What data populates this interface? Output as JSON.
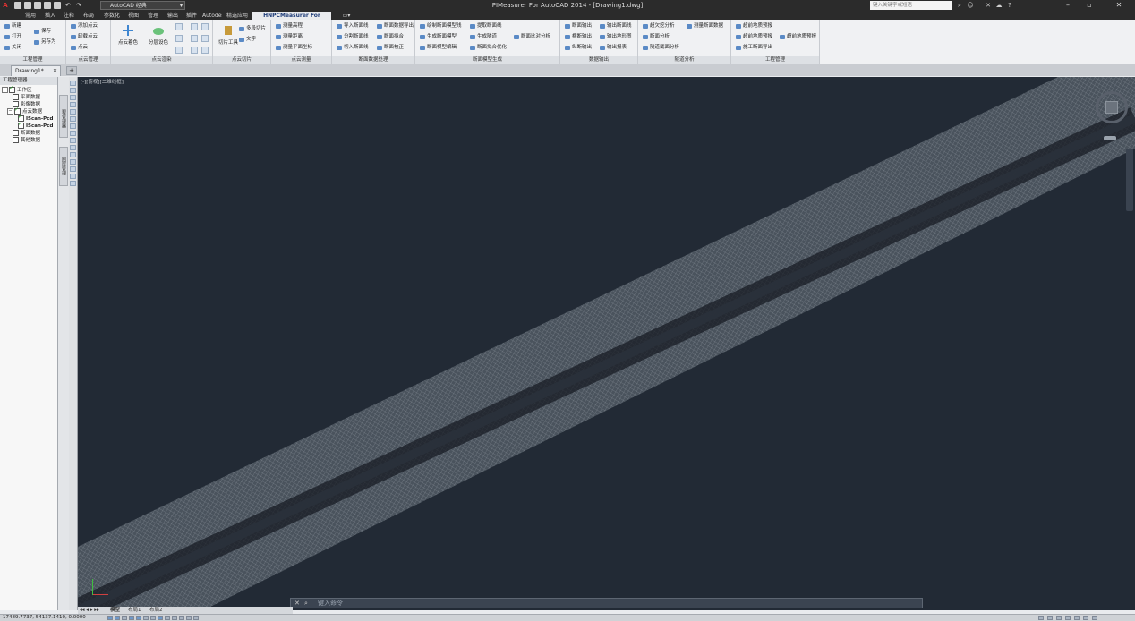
{
  "titlebar": {
    "workspace": "AutoCAD 经典",
    "title": "PIMeasurer For AutoCAD 2014 - [Drawing1.dwg]",
    "search_placeholder": "键入关键字或短语"
  },
  "ribbon_tabs": [
    "常用",
    "插入",
    "注释",
    "布局",
    "参数化",
    "视图",
    "管理",
    "输出",
    "插件",
    "Autodesk 360",
    "精选应用",
    "HNPCMeasurer For AutoCAD"
  ],
  "active_tab": "HNPCMeasurer For AutoCAD",
  "panels": {
    "p1": {
      "title": "工程管理",
      "items": [
        "新建",
        "打开",
        "关闭",
        "保存",
        "另存为"
      ]
    },
    "p2": {
      "title": "点云管理",
      "items": [
        "添加点云",
        "卸载点云",
        "点云"
      ]
    },
    "p3": {
      "title": "点云渲染",
      "big1": "点云着色",
      "big2": "分层设色"
    },
    "p4": {
      "title": "点云切片",
      "big": "切片工具",
      "items": [
        "多段切片",
        "文字"
      ]
    },
    "p5": {
      "title": "点云测量",
      "items": [
        "测量高程",
        "测量距离",
        "测量平面坐标"
      ]
    },
    "p6": {
      "title": "断面数据处理",
      "items": [
        "导入断面线",
        "分割断面线",
        "切入断面线",
        "断面数据导出",
        "断面拟合",
        "断面校正"
      ]
    },
    "p7": {
      "title": "断面模型生成",
      "items": [
        "绘制断面模型线",
        "生成断面模型",
        "断面模型编辑",
        "提取断面线",
        "生成隧道",
        "断面拟合优化",
        "断面比对分析"
      ]
    },
    "p8": {
      "title": "数据输出",
      "items": [
        "断面输出",
        "横断输出",
        "纵断输出",
        "输出断面线",
        "输出地形图",
        "输出报表"
      ]
    },
    "p9": {
      "title": "隧道分析",
      "items": [
        "超欠挖分析",
        "断面分析",
        "隧道截面分析",
        "测量断面数据"
      ]
    },
    "p10": {
      "title": "工程管理",
      "items": [
        "超前地质预报",
        "超前地质预报",
        "施工断面导出",
        "超前地质预报"
      ]
    }
  },
  "doc_tab": "Drawing1*",
  "left_panel": {
    "header": "工程管理器",
    "tree": [
      {
        "label": "工作区",
        "level": 0,
        "checked": true,
        "expanded": true
      },
      {
        "label": "平面数据",
        "level": 1,
        "checked": false
      },
      {
        "label": "影像数据",
        "level": 1,
        "checked": false
      },
      {
        "label": "点云数据",
        "level": 1,
        "checked": true,
        "expanded": true
      },
      {
        "label": "IScan-Pcd",
        "level": 2,
        "checked": true
      },
      {
        "label": "IScan-Pcd",
        "level": 2,
        "checked": true
      },
      {
        "label": "断面数据",
        "level": 1,
        "checked": false
      },
      {
        "label": "其他数据",
        "level": 1,
        "checked": false
      }
    ]
  },
  "vertical_tabs": [
    "工程管理器",
    "图层管理"
  ],
  "viewport_label": "[-][俯视][二维线框]",
  "command_line": {
    "prompt": "键入命令"
  },
  "layout_tabs": [
    "模型",
    "布局1",
    "布局2"
  ],
  "status": {
    "coords": "17489.7737, 54137.1410, 0.0000"
  },
  "colors": {
    "canvas_bg": "#222a35",
    "ribbon_bg": "#f0f1f3",
    "titlebar_bg": "#2b2b2b",
    "pointcloud": "#b9c0c8"
  },
  "icons": [
    "autocad-logo-icon",
    "new-icon",
    "open-icon",
    "save-icon",
    "undo-icon",
    "redo-icon",
    "search-icon",
    "user-icon",
    "help-icon",
    "minimize-icon",
    "maximize-icon",
    "close-icon",
    "compass-icon",
    "navcube-icon"
  ]
}
